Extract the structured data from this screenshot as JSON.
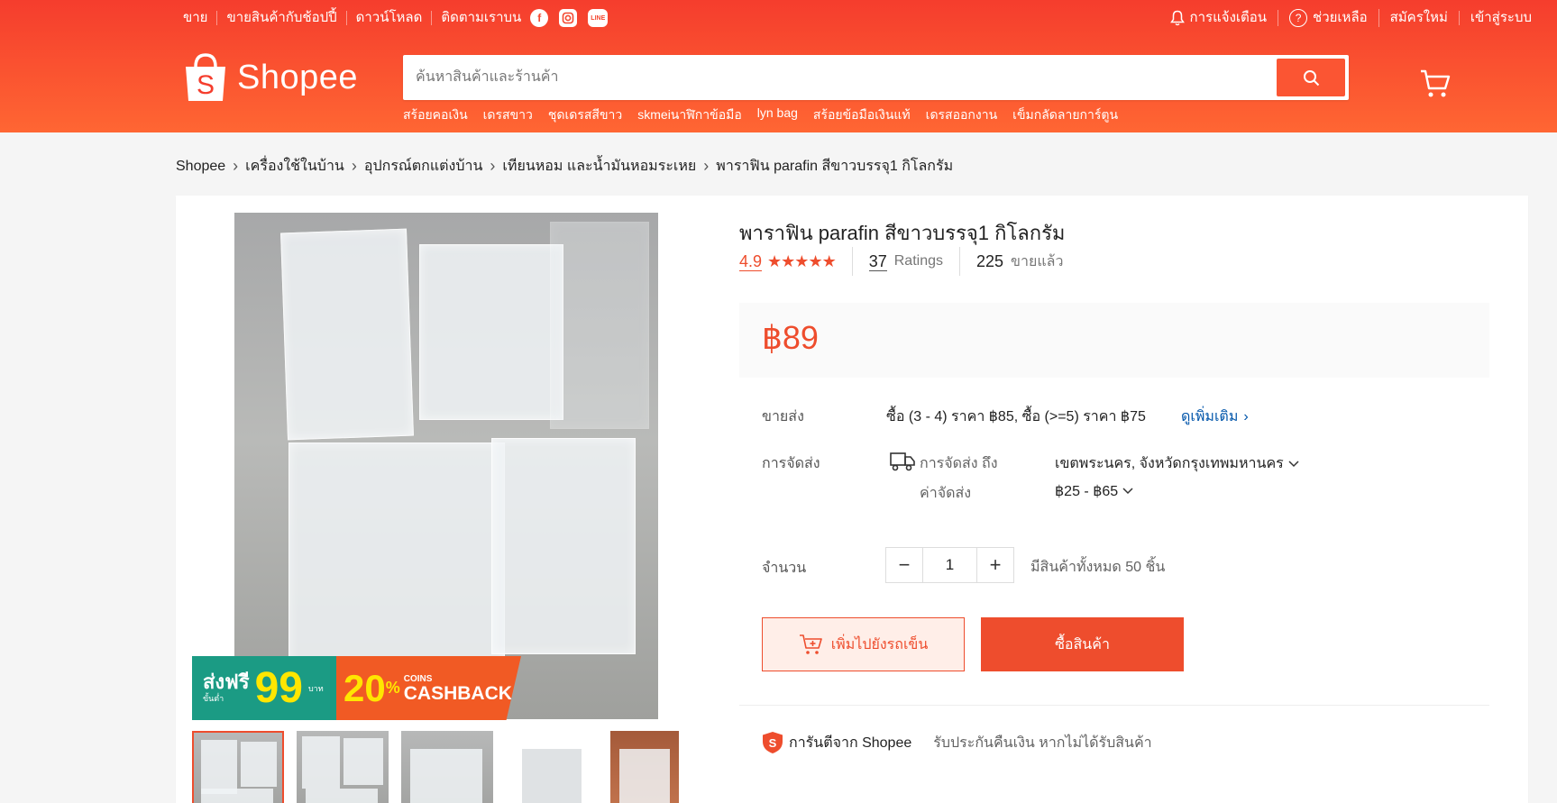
{
  "topbar": {
    "left": [
      "ขาย",
      "ขายสินค้ากับช้อปปี้",
      "ดาวน์โหลด",
      "ติดตามเราบน"
    ],
    "right": {
      "notifications": "การแจ้งเตือน",
      "help": "ช่วยเหลือ",
      "signup": "สมัครใหม่",
      "login": "เข้าสู่ระบบ"
    }
  },
  "logo": {
    "text": "Shopee",
    "bag_letter": "S"
  },
  "search": {
    "placeholder": "ค้นหาสินค้าและร้านค้า",
    "suggestions": [
      "สร้อยคอเงิน",
      "เดรสขาว",
      "ชุดเดรสสีขาว",
      "skmeiนาฬิกาข้อมือ",
      "lyn bag",
      "สร้อยข้อมือเงินแท้",
      "เดรสออกงาน",
      "เข็มกลัดลายการ์ตูน"
    ]
  },
  "breadcrumb": [
    "Shopee",
    "เครื่องใช้ในบ้าน",
    "อุปกรณ์ตกแต่งบ้าน",
    "เทียนหอม และน้ำมันหอมระเหย",
    "พาราฟิน parafin สีขาวบรรจุ1 กิโลกรัม"
  ],
  "promo": {
    "free": "ส่งฟรี",
    "min": "ขั้นต่ำ",
    "amount": "99",
    "baht": "บาท",
    "percent": "20",
    "pct_sign": "%",
    "coins": "COINS",
    "cashback": "CASHBACK"
  },
  "product": {
    "title": "พาราฟิน parafin สีขาวบรรจุ1 กิโลกรัม",
    "rating": "4.9",
    "stars": "★★★★★",
    "ratings_count": "37",
    "ratings_label": "Ratings",
    "sold_count": "225",
    "sold_label": "ขายแล้ว",
    "price": "฿89"
  },
  "wholesale": {
    "label": "ขายส่ง",
    "text": "ซื้อ (3 - 4) ราคา ฿85, ซื้อ (>=5) ราคา ฿75",
    "more": "ดูเพิ่มเติม"
  },
  "shipping": {
    "label": "การจัดส่ง",
    "to_label": "การจัดส่ง ถึง",
    "to_value": "เขตพระนคร, จังหวัดกรุงเทพมหานคร",
    "fee_label": "ค่าจัดส่ง",
    "fee_value": "฿25 - ฿65"
  },
  "quantity": {
    "label": "จำนวน",
    "value": "1",
    "stock": "มีสินค้าทั้งหมด 50 ชิ้น"
  },
  "actions": {
    "add_to_cart": "เพิ่มไปยังรถเข็น",
    "buy_now": "ซื้อสินค้า"
  },
  "guarantee": {
    "title": "การันตีจาก Shopee",
    "text": "รับประกันคืนเงิน หากไม่ได้รับสินค้า"
  },
  "colors": {
    "brand": "#ee4d2d",
    "header": "#f53d2d",
    "link": "#0055aa"
  }
}
